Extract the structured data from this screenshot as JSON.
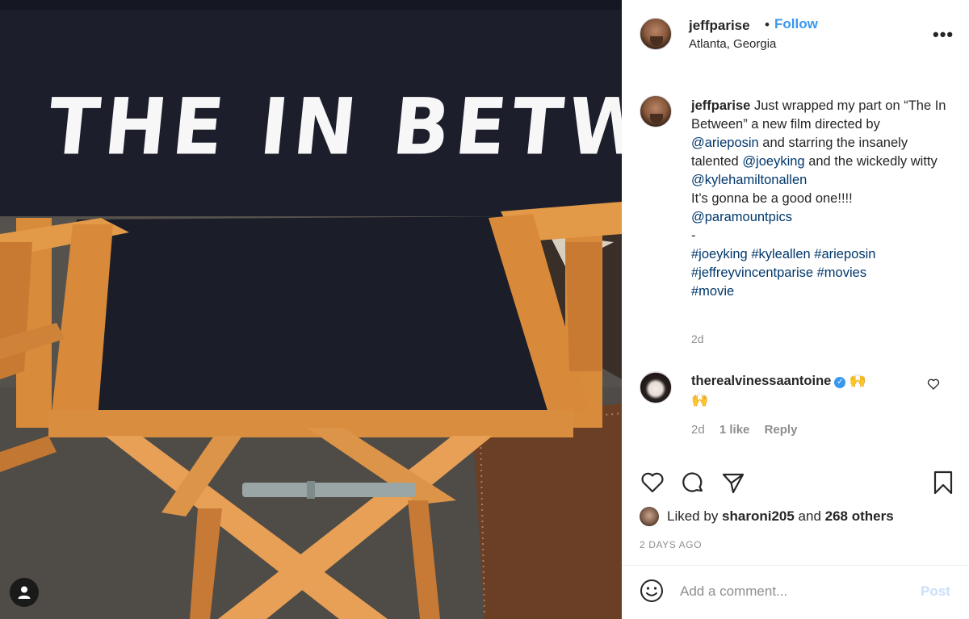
{
  "photo": {
    "chair_text": "THE IN BETWEEN",
    "tag_icon": "user-tag-icon"
  },
  "post": {
    "username": "jeffparise",
    "dot": "•",
    "follow_label": "Follow",
    "location": "Atlanta, Georgia",
    "more_icon": "more-options-icon",
    "caption": {
      "username": "jeffparise",
      "line1": " Just wrapped my part on “The In Between” a new film directed by ",
      "mention1": "@arieposin",
      "line2": " and starring the insanely talented ",
      "mention2": "@joeyking",
      "line3": " and the wickedly witty ",
      "mention3": "@kylehamiltonallen",
      "line4": "It’s gonna be a good one!!!!",
      "mention4": "@paramountpics",
      "dash": "-",
      "tag1": "#joeyking",
      "tag2": "#kyleallen",
      "tag3": "#arieposin",
      "tag4": "#jeffreyvincentparise",
      "tag5": "#movies",
      "tag6": "#movie",
      "time": "2d"
    },
    "comment": {
      "username": "therealvinessaantoine",
      "verified": "✓",
      "emoji1": "🙌",
      "emoji2": "🙌",
      "time": "2d",
      "likes": "1 like",
      "reply": "Reply"
    },
    "likes": {
      "prefix": "Liked by ",
      "user": "sharoni205",
      "middle": " and ",
      "count": "268 others"
    },
    "age": "2 DAYS AGO",
    "comment_box": {
      "placeholder": "Add a comment...",
      "post_label": "Post"
    }
  }
}
